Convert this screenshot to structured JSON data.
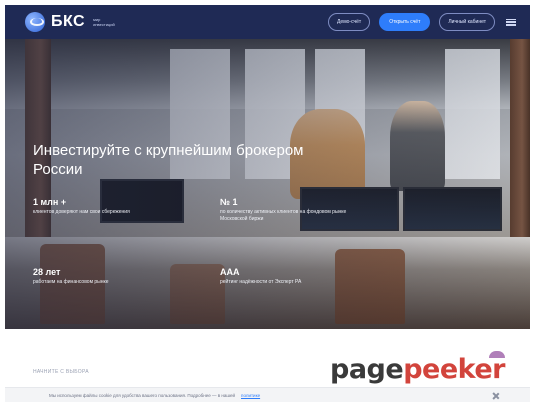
{
  "header": {
    "logo_text": "БКС",
    "logo_sub_line1": "мир",
    "logo_sub_line2": "инвестиций",
    "buttons": [
      "Демо-счёт",
      "Открыть счёт",
      "Личный кабинет"
    ]
  },
  "hero": {
    "title": "Инвестируйте с крупнейшим брокером России",
    "stats": [
      {
        "value": "1 млн +",
        "label": "клиентов доверяют нам свои сбережения"
      },
      {
        "value": "№ 1",
        "label": "по количеству активных клиентов на фондовом рынке Московской биржи"
      },
      {
        "value": "28 лет",
        "label": "работаем на финансовом рынке"
      },
      {
        "value": "AAA",
        "label": "рейтинг надёжности от Эксперт РА"
      }
    ]
  },
  "below": {
    "section_label": "НАЧНИТЕ С ВЫБОРА",
    "cookie_text": "Мы используем файлы cookie для удобства вашего пользования. Подробнее — в нашей",
    "cookie_link": "политике"
  },
  "watermark": {
    "part1": "page",
    "part2": "peeker"
  }
}
